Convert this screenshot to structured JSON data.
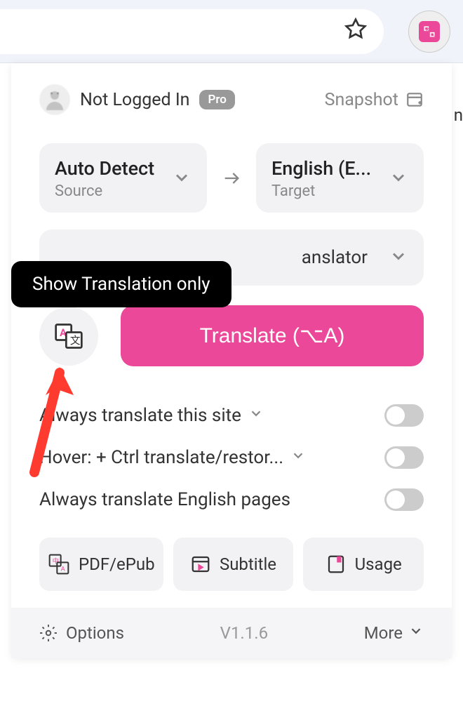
{
  "header": {
    "login_text": "Not Logged In",
    "pro_label": "Pro",
    "snapshot_label": "Snapshot"
  },
  "lang": {
    "source_main": "Auto Detect",
    "source_sub": "Source",
    "target_main": "English (E...",
    "target_sub": "Target"
  },
  "translator": {
    "label": "anslator"
  },
  "tooltip": {
    "text": "Show Translation only"
  },
  "main_button": {
    "label": "Translate (⌥A)"
  },
  "settings": {
    "always_site": "Always translate this site",
    "hover": "Hover:  + Ctrl translate/restor...",
    "always_eng": "Always translate English pages"
  },
  "bottom": {
    "pdf": "PDF/ePub",
    "subtitle": "Subtitle",
    "usage": "Usage"
  },
  "footer": {
    "options": "Options",
    "version": "V1.1.6",
    "more": "More"
  }
}
